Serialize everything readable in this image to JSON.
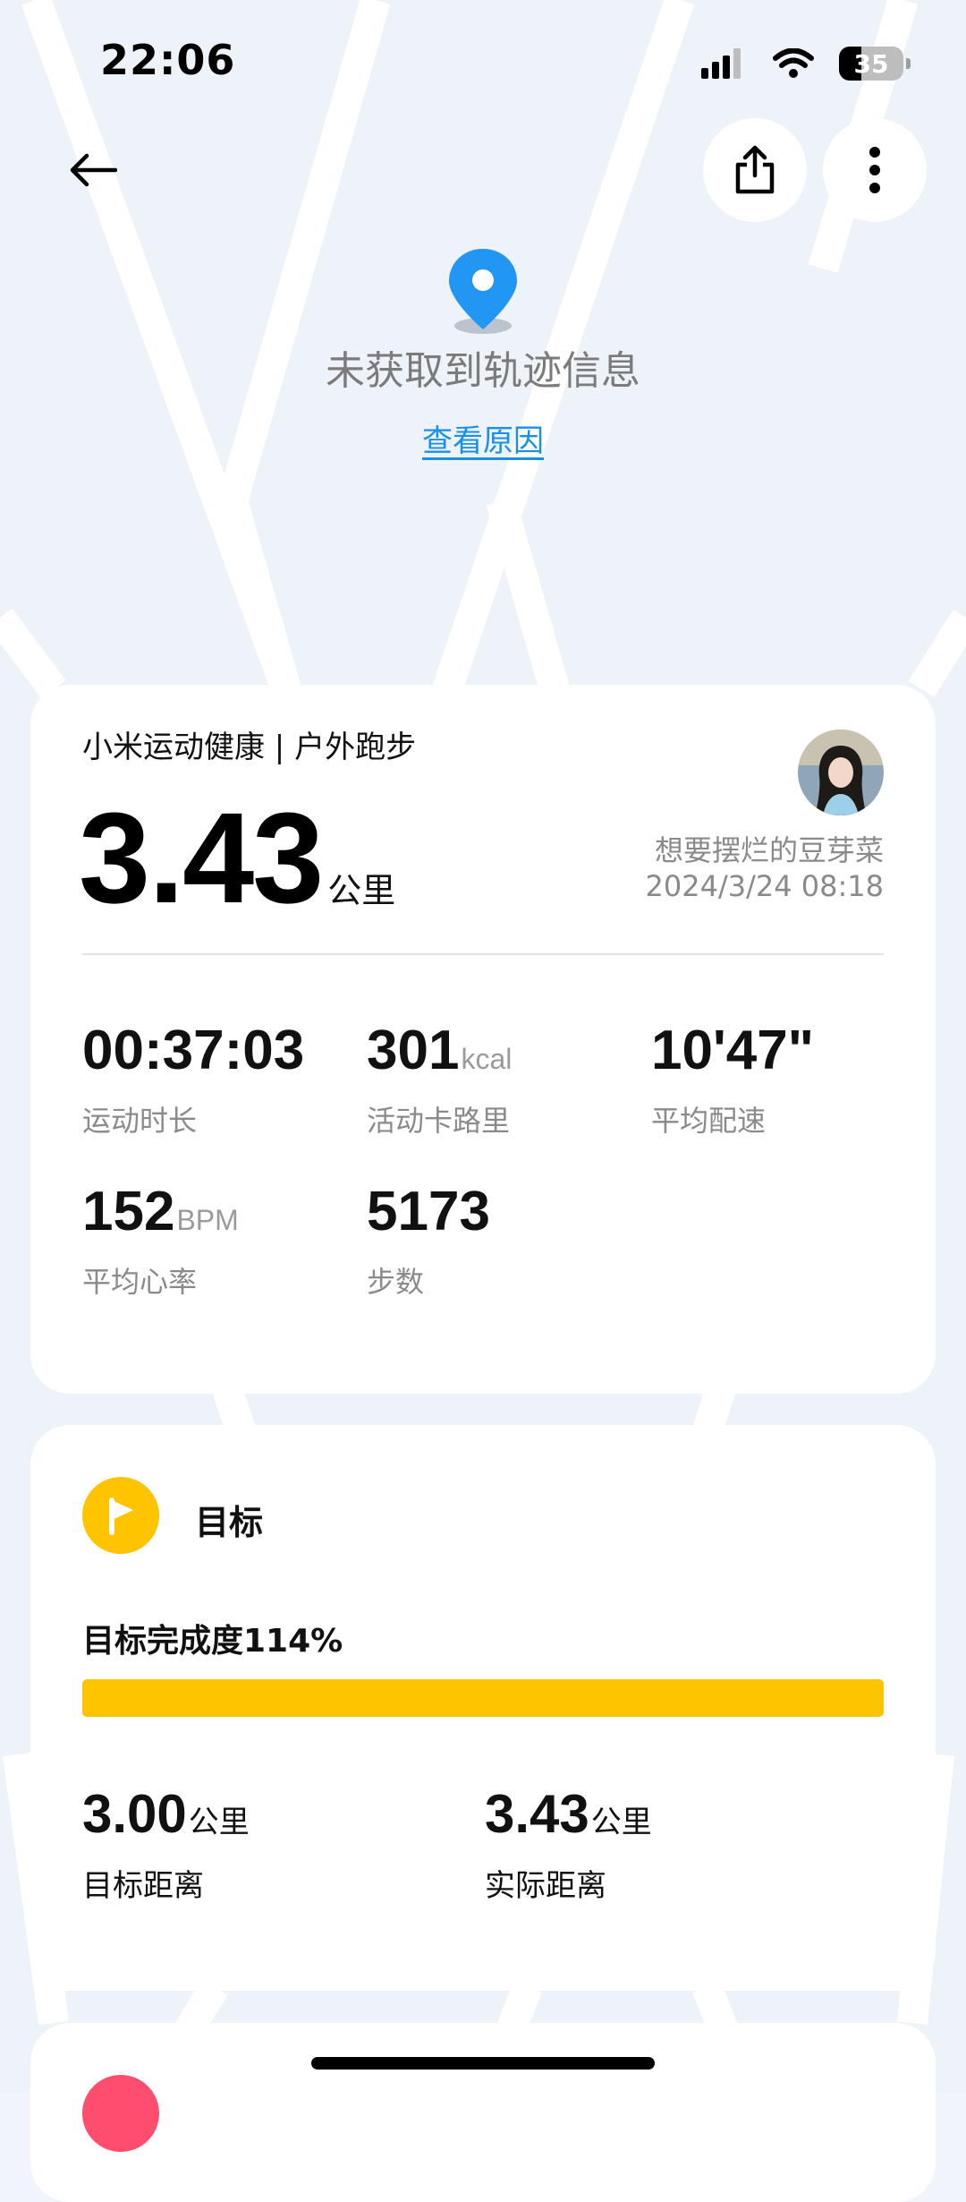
{
  "status_bar": {
    "time": "22:06",
    "battery": "35",
    "battery_level": 0.35,
    "icons": [
      "cellular-signal-icon",
      "wifi-icon",
      "battery-icon"
    ]
  },
  "header": {
    "back_icon": "arrow-left-icon",
    "share_icon": "share-icon",
    "more_icon": "more-vertical-icon"
  },
  "map": {
    "pin_icon": "location-pin-icon",
    "no_track_text": "未获取到轨迹信息",
    "view_reason_link": "查看原因"
  },
  "summary": {
    "app_title": "小米运动健康 | 户外跑步",
    "distance": "3.43",
    "distance_unit": "公里",
    "username": "想要摆烂的豆芽菜",
    "datetime": "2024/3/24 08:18",
    "metrics": {
      "duration": {
        "value": "00:37:03",
        "label": "运动时长"
      },
      "calories": {
        "value": "301",
        "unit": "kcal",
        "label": "活动卡路里"
      },
      "pace": {
        "value": "10'47\"",
        "label": "平均配速"
      },
      "heart_rate": {
        "value": "152",
        "unit": "BPM",
        "label": "平均心率"
      },
      "steps": {
        "value": "5173",
        "label": "步数"
      }
    }
  },
  "goal": {
    "title": "目标",
    "completion_text": "目标完成度114%",
    "completion_fraction": 1.0,
    "target_distance": {
      "value": "3.00",
      "unit": "公里",
      "label": "目标距离"
    },
    "actual_distance": {
      "value": "3.43",
      "unit": "公里",
      "label": "实际距离"
    }
  },
  "colors": {
    "accent_yellow": "#ffc400",
    "link_blue": "#1990e8",
    "pin_blue": "#2196f3",
    "background": "#f1f5fb"
  }
}
